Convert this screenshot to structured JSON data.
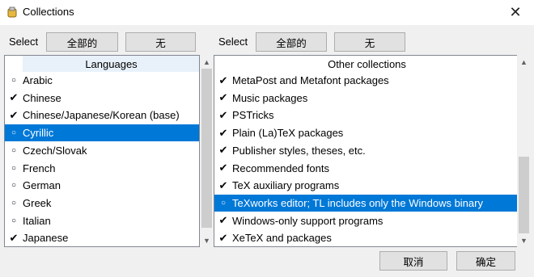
{
  "window": {
    "title": "Collections",
    "close_glyph": "✕"
  },
  "left": {
    "select_label": "Select",
    "all_button": "全部的",
    "none_button": "无",
    "header": "Languages",
    "items": [
      {
        "label": "Arabic",
        "mark": "○"
      },
      {
        "label": "Chinese",
        "mark": "✔"
      },
      {
        "label": "Chinese/Japanese/Korean (base)",
        "mark": "✔"
      },
      {
        "label": "Cyrillic",
        "mark": "○"
      },
      {
        "label": "Czech/Slovak",
        "mark": "○"
      },
      {
        "label": "French",
        "mark": "○"
      },
      {
        "label": "German",
        "mark": "○"
      },
      {
        "label": "Greek",
        "mark": "○"
      },
      {
        "label": "Italian",
        "mark": "○"
      },
      {
        "label": "Japanese",
        "mark": "✔"
      }
    ]
  },
  "right": {
    "select_label": "Select",
    "all_button": "全部的",
    "none_button": "无",
    "header": "Other collections",
    "items": [
      {
        "label": "MetaPost and Metafont packages",
        "mark": "✔"
      },
      {
        "label": "Music packages",
        "mark": "✔"
      },
      {
        "label": "PSTricks",
        "mark": "✔"
      },
      {
        "label": "Plain (La)TeX packages",
        "mark": "✔"
      },
      {
        "label": "Publisher styles, theses, etc.",
        "mark": "✔"
      },
      {
        "label": "Recommended fonts",
        "mark": "✔"
      },
      {
        "label": "TeX auxiliary programs",
        "mark": "✔"
      },
      {
        "label": "TeXworks editor; TL includes only the Windows binary",
        "mark": "○"
      },
      {
        "label": "Windows-only support programs",
        "mark": "✔"
      },
      {
        "label": "XeTeX and packages",
        "mark": "✔"
      }
    ]
  },
  "footer": {
    "cancel_button": "取消",
    "ok_button": "确定"
  },
  "colors": {
    "selection": "#0078d7",
    "window_bg": "#f0f0f0"
  }
}
